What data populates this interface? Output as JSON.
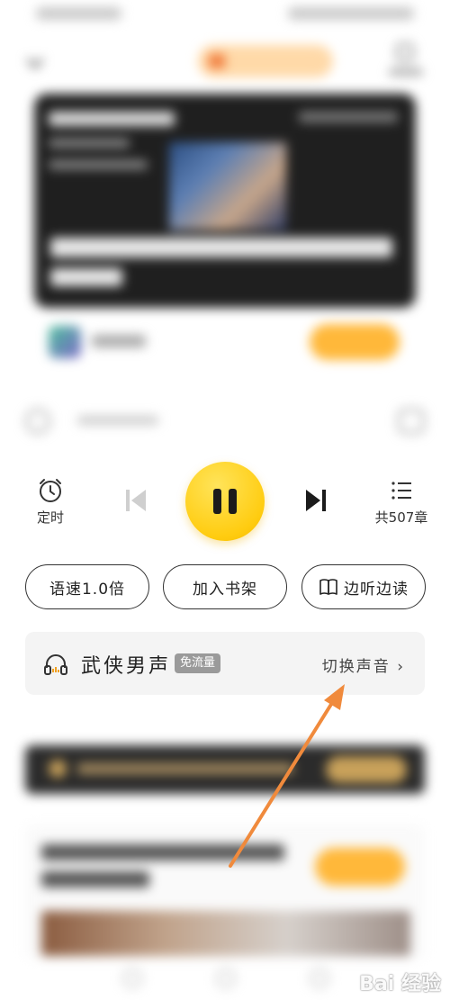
{
  "controls": {
    "timer_label": "定时",
    "chapters_label": "共507章"
  },
  "actions": {
    "speed_label": "语速1.0倍",
    "add_shelf_label": "加入书架",
    "listen_read_label": "边听边读"
  },
  "voice": {
    "name": "武侠男声",
    "badge": "免流量",
    "switch_label": "切换声音",
    "switch_chevron": "›"
  },
  "colors": {
    "play_button": "#ffcc10",
    "arrow": "#f08a3c"
  },
  "watermark": {
    "text": "Bai 经验"
  }
}
